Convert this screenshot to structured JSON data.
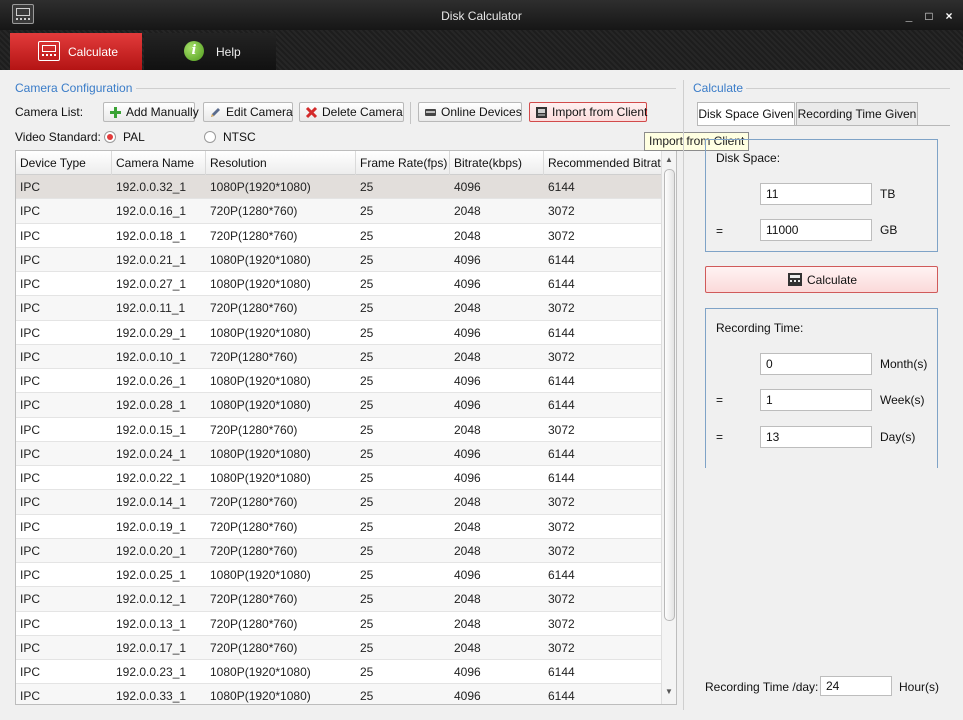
{
  "window": {
    "title": "Disk Calculator",
    "min_glyph": "_",
    "max_glyph": "□",
    "close_glyph": "×"
  },
  "tabs": {
    "calculate": "Calculate",
    "help": "Help",
    "help_icon_glyph": "i"
  },
  "camera_config": {
    "group_title": "Camera Configuration",
    "camera_list_label": "Camera List:",
    "buttons": {
      "add_manually": "Add Manually",
      "edit_camera": "Edit Camera",
      "delete_camera": "Delete Camera",
      "online_devices": "Online Devices",
      "import_from_client": "Import from Client"
    },
    "video_standard_label": "Video Standard:",
    "video_standard_options": [
      "PAL",
      "NTSC"
    ],
    "video_standard_selected": "PAL",
    "tooltip": "Import from Client"
  },
  "table": {
    "columns": [
      "Device Type",
      "Camera Name",
      "Resolution",
      "Frame Rate(fps)",
      "Bitrate(kbps)",
      "Recommended Bitrat"
    ],
    "selected_row_index": 0,
    "rows": [
      [
        "IPC",
        "192.0.0.32_1",
        "1080P(1920*1080)",
        "25",
        "4096",
        "6144"
      ],
      [
        "IPC",
        "192.0.0.16_1",
        "720P(1280*760)",
        "25",
        "2048",
        "3072"
      ],
      [
        "IPC",
        "192.0.0.18_1",
        "720P(1280*760)",
        "25",
        "2048",
        "3072"
      ],
      [
        "IPC",
        "192.0.0.21_1",
        "1080P(1920*1080)",
        "25",
        "4096",
        "6144"
      ],
      [
        "IPC",
        "192.0.0.27_1",
        "1080P(1920*1080)",
        "25",
        "4096",
        "6144"
      ],
      [
        "IPC",
        "192.0.0.11_1",
        "720P(1280*760)",
        "25",
        "2048",
        "3072"
      ],
      [
        "IPC",
        "192.0.0.29_1",
        "1080P(1920*1080)",
        "25",
        "4096",
        "6144"
      ],
      [
        "IPC",
        "192.0.0.10_1",
        "720P(1280*760)",
        "25",
        "2048",
        "3072"
      ],
      [
        "IPC",
        "192.0.0.26_1",
        "1080P(1920*1080)",
        "25",
        "4096",
        "6144"
      ],
      [
        "IPC",
        "192.0.0.28_1",
        "1080P(1920*1080)",
        "25",
        "4096",
        "6144"
      ],
      [
        "IPC",
        "192.0.0.15_1",
        "720P(1280*760)",
        "25",
        "2048",
        "3072"
      ],
      [
        "IPC",
        "192.0.0.24_1",
        "1080P(1920*1080)",
        "25",
        "4096",
        "6144"
      ],
      [
        "IPC",
        "192.0.0.22_1",
        "1080P(1920*1080)",
        "25",
        "4096",
        "6144"
      ],
      [
        "IPC",
        "192.0.0.14_1",
        "720P(1280*760)",
        "25",
        "2048",
        "3072"
      ],
      [
        "IPC",
        "192.0.0.19_1",
        "720P(1280*760)",
        "25",
        "2048",
        "3072"
      ],
      [
        "IPC",
        "192.0.0.20_1",
        "720P(1280*760)",
        "25",
        "2048",
        "3072"
      ],
      [
        "IPC",
        "192.0.0.25_1",
        "1080P(1920*1080)",
        "25",
        "4096",
        "6144"
      ],
      [
        "IPC",
        "192.0.0.12_1",
        "720P(1280*760)",
        "25",
        "2048",
        "3072"
      ],
      [
        "IPC",
        "192.0.0.13_1",
        "720P(1280*760)",
        "25",
        "2048",
        "3072"
      ],
      [
        "IPC",
        "192.0.0.17_1",
        "720P(1280*760)",
        "25",
        "2048",
        "3072"
      ],
      [
        "IPC",
        "192.0.0.23_1",
        "1080P(1920*1080)",
        "25",
        "4096",
        "6144"
      ],
      [
        "IPC",
        "192.0.0.33_1",
        "1080P(1920*1080)",
        "25",
        "4096",
        "6144"
      ]
    ]
  },
  "calculate_panel": {
    "group_title": "Calculate",
    "tabs": [
      "Disk Space Given",
      "Recording Time Given"
    ],
    "active_tab": "Disk Space Given",
    "disk_space": {
      "label": "Disk Space:",
      "tb_value": "11",
      "tb_unit": "TB",
      "eq": "=",
      "gb_value": "11000",
      "gb_unit": "GB"
    },
    "calculate_button": "Calculate",
    "recording_time": {
      "label": "Recording Time:",
      "months_value": "0",
      "months_unit": "Month(s)",
      "weeks_value": "1",
      "weeks_unit": "Week(s)",
      "days_value": "13",
      "days_unit": "Day(s)",
      "eq": "="
    },
    "recording_per_day": {
      "label": "Recording Time /day:",
      "value": "24",
      "unit": "Hour(s)"
    }
  },
  "colors": {
    "accent_red": "#e23b3b",
    "group_title_blue": "#3a7cc8",
    "tooltip_bg": "#ffffe1"
  }
}
